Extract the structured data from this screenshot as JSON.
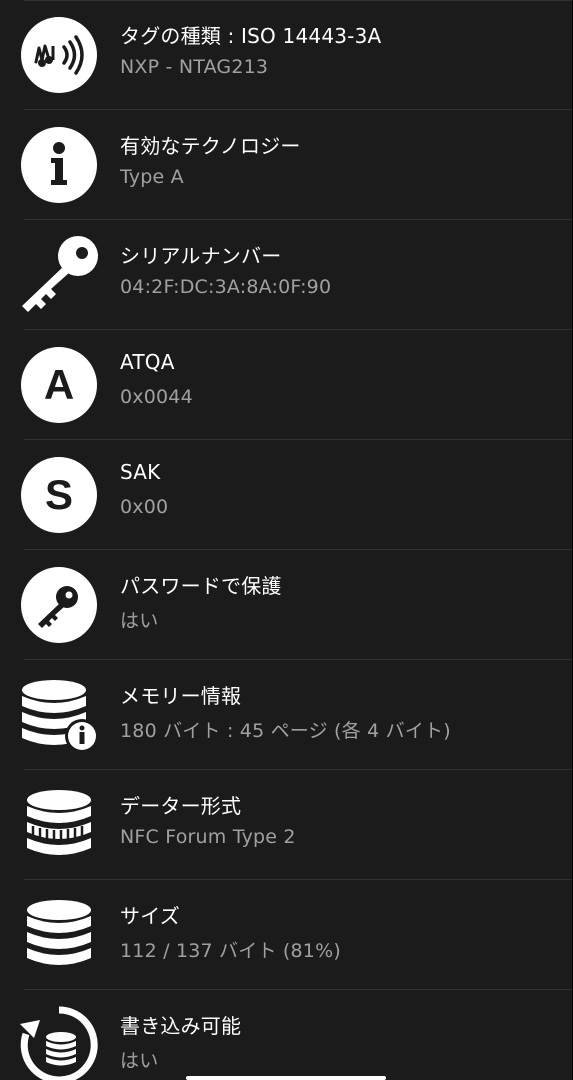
{
  "rows": [
    {
      "title": "タグの種類 : ISO 14443-3A",
      "value": "NXP - NTAG213",
      "icon": "nfc-tag-icon"
    },
    {
      "title": "有効なテクノロジー",
      "value": "Type A",
      "icon": "info-icon"
    },
    {
      "title": "シリアルナンバー",
      "value": "04:2F:DC:3A:8A:0F:90",
      "icon": "key-icon"
    },
    {
      "title": "ATQA",
      "value": "0x0044",
      "icon": "letter-a-icon"
    },
    {
      "title": "SAK",
      "value": "0x00",
      "icon": "letter-s-icon"
    },
    {
      "title": "パスワードで保護",
      "value": "はい",
      "icon": "key-circle-icon"
    },
    {
      "title": "メモリー情報",
      "value": "180 バイト : 45 ページ (各 4 バイト)",
      "icon": "database-info-icon"
    },
    {
      "title": "データー形式",
      "value": "NFC Forum Type 2",
      "icon": "database-striped-icon"
    },
    {
      "title": "サイズ",
      "value": "112 / 137 バイト (81%)",
      "icon": "database-icon"
    },
    {
      "title": "書き込み可能",
      "value": "はい",
      "icon": "database-rotate-icon"
    }
  ],
  "colors": {
    "background": "#1b1b1b",
    "title": "#ffffff",
    "value": "#a0a0a0",
    "separator": "#323232",
    "icon": "#ffffff"
  }
}
